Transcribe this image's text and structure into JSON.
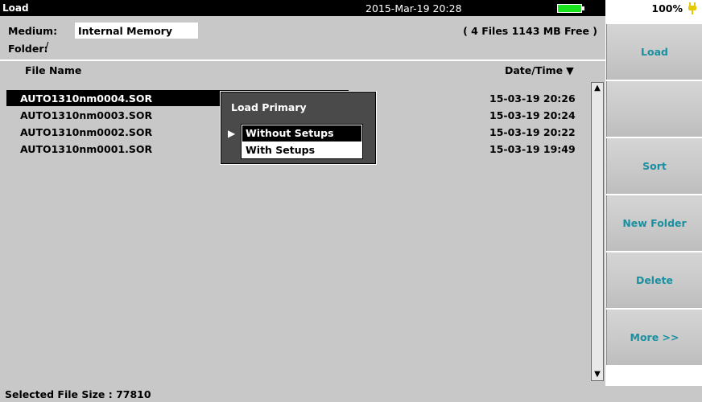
{
  "titlebar": {
    "title": "Load",
    "datetime": "2015-Mar-19 20:28",
    "battery_percent": "100%",
    "battery_level": 1.0,
    "battery_color": "#19e51d"
  },
  "info": {
    "medium_label": "Medium:",
    "medium_value": "Internal Memory",
    "folder_label": "Folder:",
    "folder_value": "/",
    "file_count": "( 4 Files   1143 MB Free )"
  },
  "columns": {
    "name": "File Name",
    "date": "Date/Time",
    "sort_indicator": "▼"
  },
  "files": [
    {
      "name": "AUTO1310nm0004.SOR",
      "date": "15-03-19 20:26",
      "selected": true
    },
    {
      "name": "AUTO1310nm0003.SOR",
      "date": "15-03-19 20:24",
      "selected": false
    },
    {
      "name": "AUTO1310nm0002.SOR",
      "date": "15-03-19 20:22",
      "selected": false
    },
    {
      "name": "AUTO1310nm0001.SOR",
      "date": "15-03-19 19:49",
      "selected": false
    }
  ],
  "popup": {
    "title": "Load Primary",
    "options": [
      "Without Setups",
      "With Setups"
    ],
    "selected_index": 0
  },
  "softkeys": [
    "Load",
    "",
    "Sort",
    "New Folder",
    "Delete",
    "More >>"
  ],
  "softkey_color": "#1a8fa0",
  "status": {
    "text": "Selected File Size : 77810"
  }
}
